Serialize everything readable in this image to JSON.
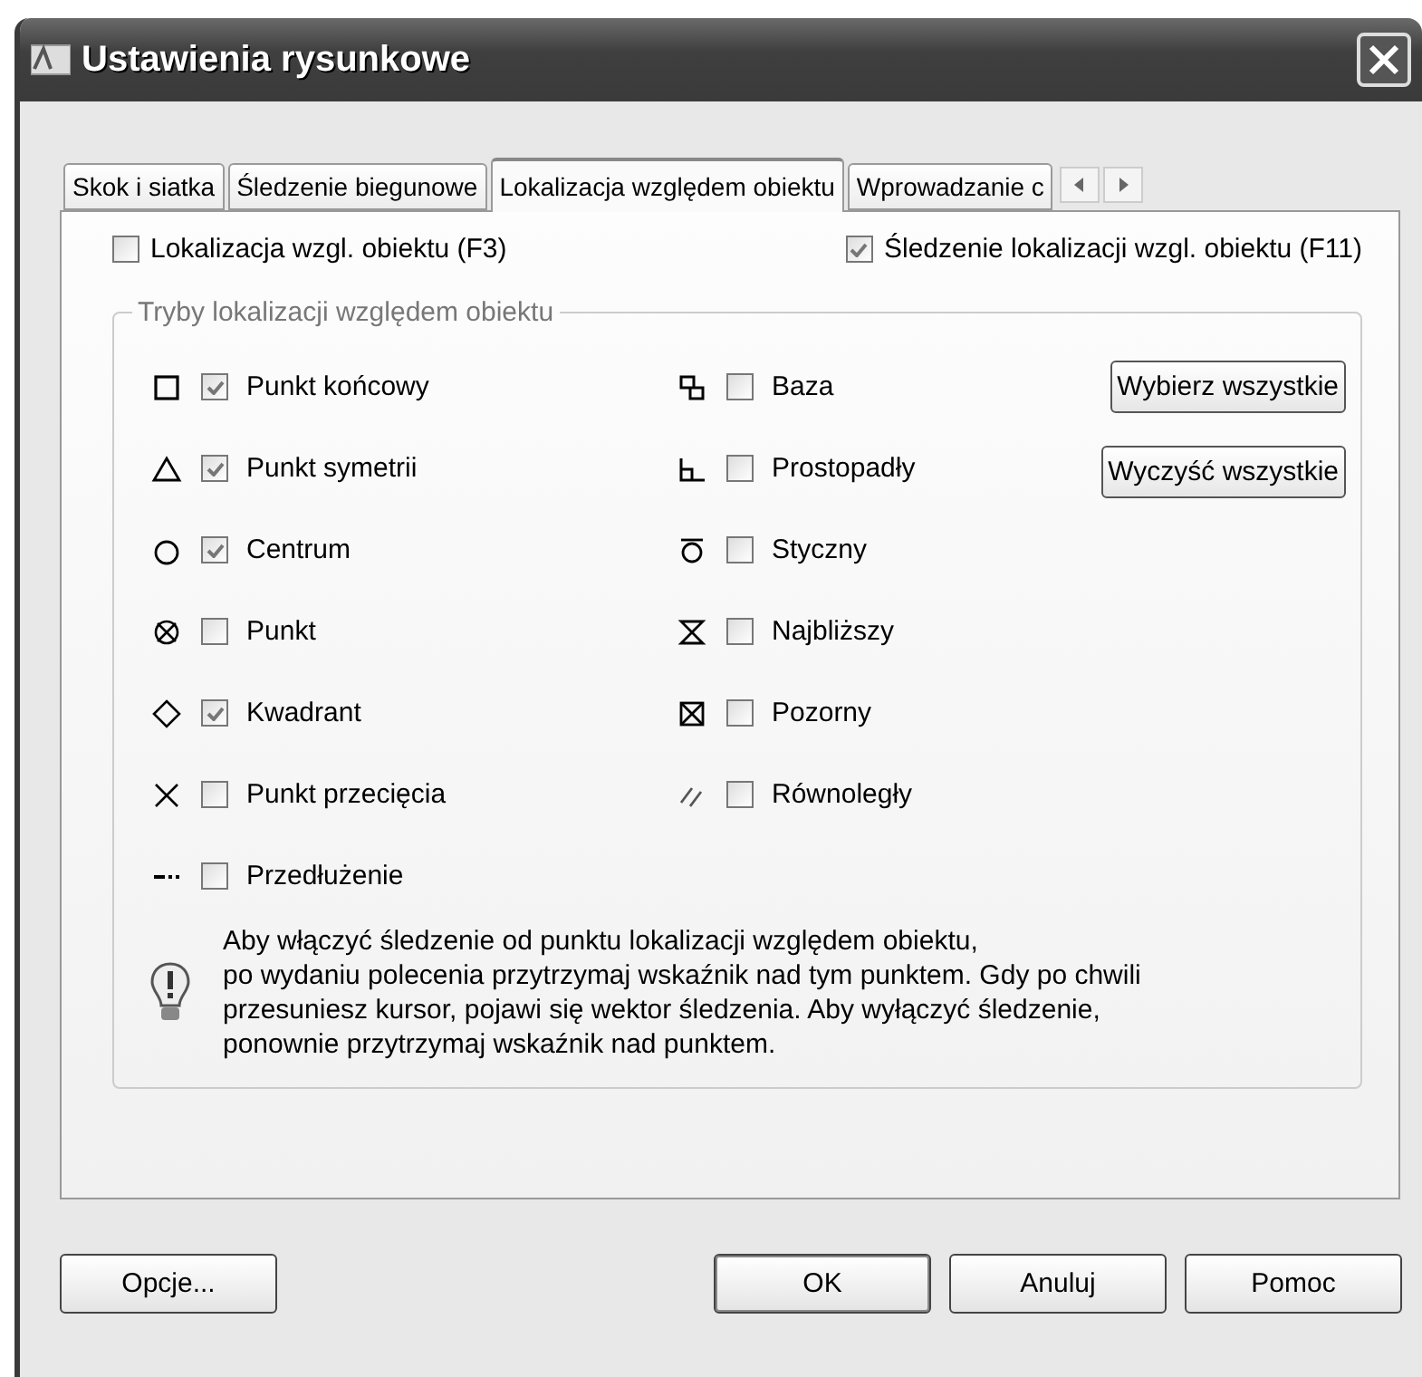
{
  "window": {
    "title": "Ustawienia rysunkowe"
  },
  "tabs": [
    {
      "label": "Skok i siatka",
      "selected": false
    },
    {
      "label": "Śledzenie biegunowe",
      "selected": false
    },
    {
      "label": "Lokalizacja względem obiektu",
      "selected": true
    },
    {
      "label": "Wprowadzanie c",
      "selected": false
    }
  ],
  "top_options": [
    {
      "label": "Lokalizacja wzgl. obiektu (F3)",
      "checked": false
    },
    {
      "label": "Śledzenie lokalizacji wzgl. obiektu (F11)",
      "checked": true
    }
  ],
  "group": {
    "title": "Tryby lokalizacji względem obiektu",
    "left_modes": [
      {
        "kind": "endpoint",
        "label": "Punkt końcowy",
        "checked": true
      },
      {
        "kind": "midpoint",
        "label": "Punkt symetrii",
        "checked": true
      },
      {
        "kind": "center",
        "label": "Centrum",
        "checked": true
      },
      {
        "kind": "node",
        "label": "Punkt",
        "checked": false
      },
      {
        "kind": "quadrant",
        "label": "Kwadrant",
        "checked": true
      },
      {
        "kind": "intersection",
        "label": "Punkt przecięcia",
        "checked": false
      },
      {
        "kind": "extension",
        "label": "Przedłużenie",
        "checked": false
      }
    ],
    "right_modes": [
      {
        "kind": "insertion",
        "label": "Baza",
        "checked": false
      },
      {
        "kind": "perpendicular",
        "label": "Prostopadły",
        "checked": false
      },
      {
        "kind": "tangent",
        "label": "Styczny",
        "checked": false
      },
      {
        "kind": "nearest",
        "label": "Najbliższy",
        "checked": false
      },
      {
        "kind": "apparent",
        "label": "Pozorny",
        "checked": false
      },
      {
        "kind": "parallel",
        "label": "Równoległy",
        "checked": false
      }
    ],
    "buttons": [
      "Wybierz wszystkie",
      "Wyczyść wszystkie"
    ],
    "hint": "Aby włączyć śledzenie od punktu lokalizacji względem obiektu,\npo wydaniu polecenia przytrzymaj wskaźnik nad tym punktem. Gdy po chwili przesuniesz kursor, pojawi się wektor śledzenia. Aby wyłączyć śledzenie, ponownie przytrzymaj wskaźnik nad punktem."
  },
  "footer": {
    "left_button": "Opcje...",
    "buttons": [
      "OK",
      "Anuluj",
      "Pomoc"
    ]
  }
}
